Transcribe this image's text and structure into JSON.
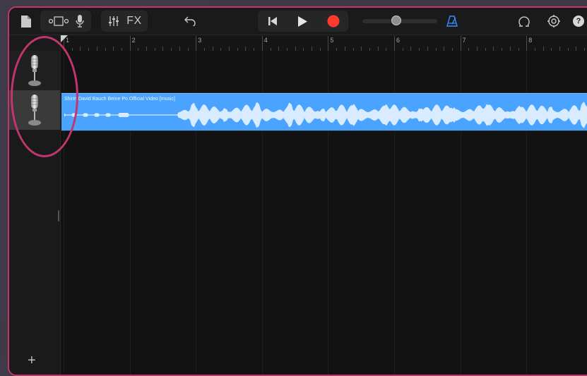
{
  "toolbar": {
    "fx_label": "FX",
    "help_label": "?",
    "icons": [
      "document-icon",
      "view-toggle-icon",
      "microphone-icon",
      "mixer-icon",
      "fx-icon",
      "undo-icon",
      "go-to-start-icon",
      "play-icon",
      "record-icon",
      "metronome-icon",
      "loop-icon",
      "settings-icon",
      "help-icon"
    ],
    "record_color": "#ff3b30",
    "metronome_color": "#3b8dff",
    "master_volume": 0.45
  },
  "ruler": {
    "bars": [
      "1",
      "2",
      "3",
      "4",
      "5",
      "6",
      "7",
      "8"
    ]
  },
  "tracks": [
    {
      "name": "",
      "icon": "microphone-icon",
      "selected": false
    },
    {
      "name": "",
      "icon": "microphone-icon",
      "selected": true
    }
  ],
  "region": {
    "title": "Shirin David Bauch Beine Po Official Video [music]",
    "color": "#4aa3ff"
  },
  "sidebar": {
    "add_label": "+"
  }
}
